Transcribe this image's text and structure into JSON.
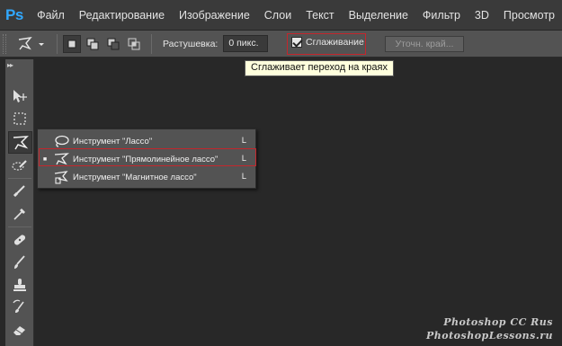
{
  "app": {
    "logo": "Ps"
  },
  "menu": [
    "Файл",
    "Редактирование",
    "Изображение",
    "Слои",
    "Текст",
    "Выделение",
    "Фильтр",
    "3D",
    "Просмотр"
  ],
  "options": {
    "feather_label": "Растушевка:",
    "feather_value": "0 пикс.",
    "antialias_label": "Сглаживание",
    "antialias_checked": true,
    "refine_edge_label": "Уточн. край..."
  },
  "tooltip": {
    "text": "Сглаживает переход на краях"
  },
  "flyout": {
    "items": [
      {
        "label": "Инструмент \"Лассо\"",
        "shortcut": "L",
        "selected": false,
        "icon": "lasso-icon"
      },
      {
        "label": "Инструмент \"Прямолинейное лассо\"",
        "shortcut": "L",
        "selected": true,
        "icon": "polygonal-lasso-icon"
      },
      {
        "label": "Инструмент \"Магнитное лассо\"",
        "shortcut": "L",
        "selected": false,
        "icon": "magnetic-lasso-icon"
      }
    ]
  },
  "watermark": {
    "line1": "Photoshop CC Rus",
    "line2": "PhotoshopLessons.ru"
  },
  "colors": {
    "highlight": "#c4262c",
    "ps_blue": "#31a8ff",
    "tooltip_bg": "#ffffdd"
  }
}
